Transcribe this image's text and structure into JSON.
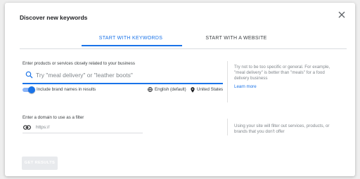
{
  "dialog": {
    "title": "Discover new keywords",
    "close_icon": "close-icon"
  },
  "tabs": [
    {
      "label": "START WITH KEYWORDS",
      "selected": true
    },
    {
      "label": "START WITH A WEBSITE",
      "selected": false
    }
  ],
  "keywords_section": {
    "label": "Enter products or services closely related to your business",
    "search_icon": "search-icon",
    "search_placeholder": "Try \"meal delivery\" or \"leather boots\"",
    "search_value": "",
    "brand_toggle_on": true,
    "brand_toggle_label": "Include brand names in results",
    "language_icon": "globe-icon",
    "language": "English (default)",
    "location_icon": "location-pin-icon",
    "location": "United States",
    "hint": "Try not to be too specific or general. For example, \"meal delivery\" is better than \"meals\" for a food delivery business",
    "learn_more": "Learn more"
  },
  "domain_section": {
    "label": "Enter a domain to use as a filter",
    "link_icon": "link-icon",
    "domain_placeholder": "https://",
    "domain_value": "",
    "hint": "Using your site will filter out services, products, or brands that you don't offer"
  },
  "actions": {
    "get_results_label": "GET RESULTS",
    "get_results_enabled": false
  },
  "colors": {
    "accent": "#1a73e8",
    "toggle_track": "#8ab4f8",
    "hint_text": "#80868b",
    "disabled_button": "#e8eaed"
  }
}
